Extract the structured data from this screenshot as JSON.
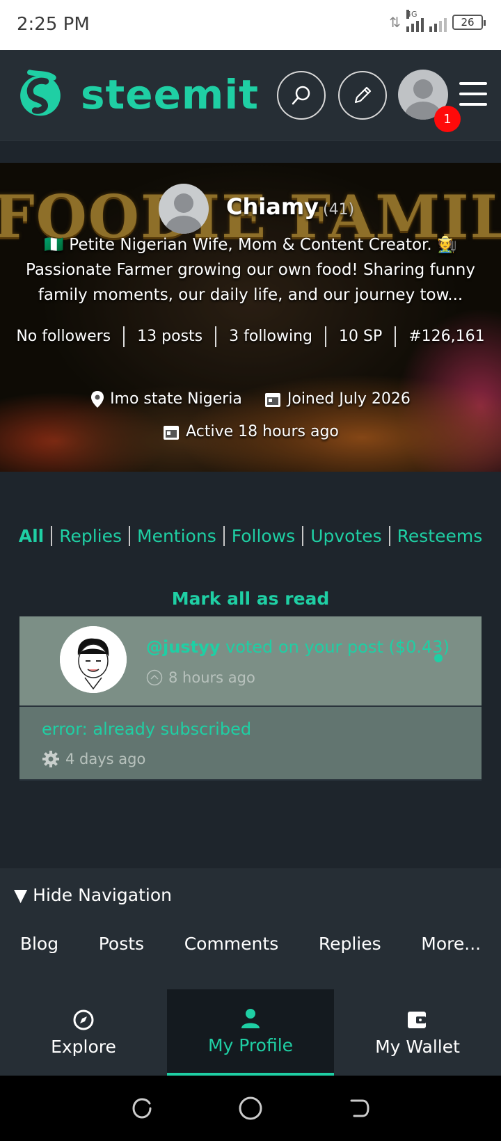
{
  "status_bar": {
    "time": "2:25 PM",
    "network": "4G",
    "battery": "26"
  },
  "header": {
    "logo_text": "steemit",
    "notification_count": "1",
    "icons": {
      "search": "search-icon",
      "edit": "pencil-icon",
      "avatar": "user-avatar-icon",
      "menu": "hamburger-menu-icon"
    },
    "brand_color": "#1fcfa4"
  },
  "profile": {
    "banner_text": "FOODIE FAMILY",
    "name": "Chiamy",
    "reputation": "(41)",
    "bio": "🇳🇬 Petite Nigerian Wife, Mom & Content Creator. 🧑‍🌾 Passionate Farmer growing our own food! Sharing funny family moments, our daily life, and our journey tow...",
    "stats": {
      "followers": "No followers",
      "posts": "13 posts",
      "following": "3 following",
      "sp": "10 SP",
      "rank": "#126,161"
    },
    "location": "Imo state Nigeria",
    "joined": "Joined July 2026",
    "active": "Active 18 hours ago"
  },
  "filters": {
    "items": [
      "All",
      "Replies",
      "Mentions",
      "Follows",
      "Upvotes",
      "Resteems"
    ],
    "active": "All"
  },
  "mark_all_read": "Mark all as read",
  "notifications": [
    {
      "user": "@justyy",
      "text": " voted on your post ($0.43)",
      "time": "8 hours ago",
      "icon": "upvote-icon",
      "unread": true
    },
    {
      "text": "error: already subscribed",
      "time": "4 days ago",
      "icon": "gear-icon",
      "unread": false
    }
  ],
  "nav": {
    "toggle_label": "▼ Hide Navigation",
    "links": [
      "Blog",
      "Posts",
      "Comments",
      "Replies",
      "More..."
    ]
  },
  "tabbar": {
    "tabs": [
      {
        "label": "Explore",
        "icon": "compass-icon"
      },
      {
        "label": "My Profile",
        "icon": "person-icon"
      },
      {
        "label": "My Wallet",
        "icon": "wallet-icon"
      }
    ],
    "active": "My Profile"
  }
}
